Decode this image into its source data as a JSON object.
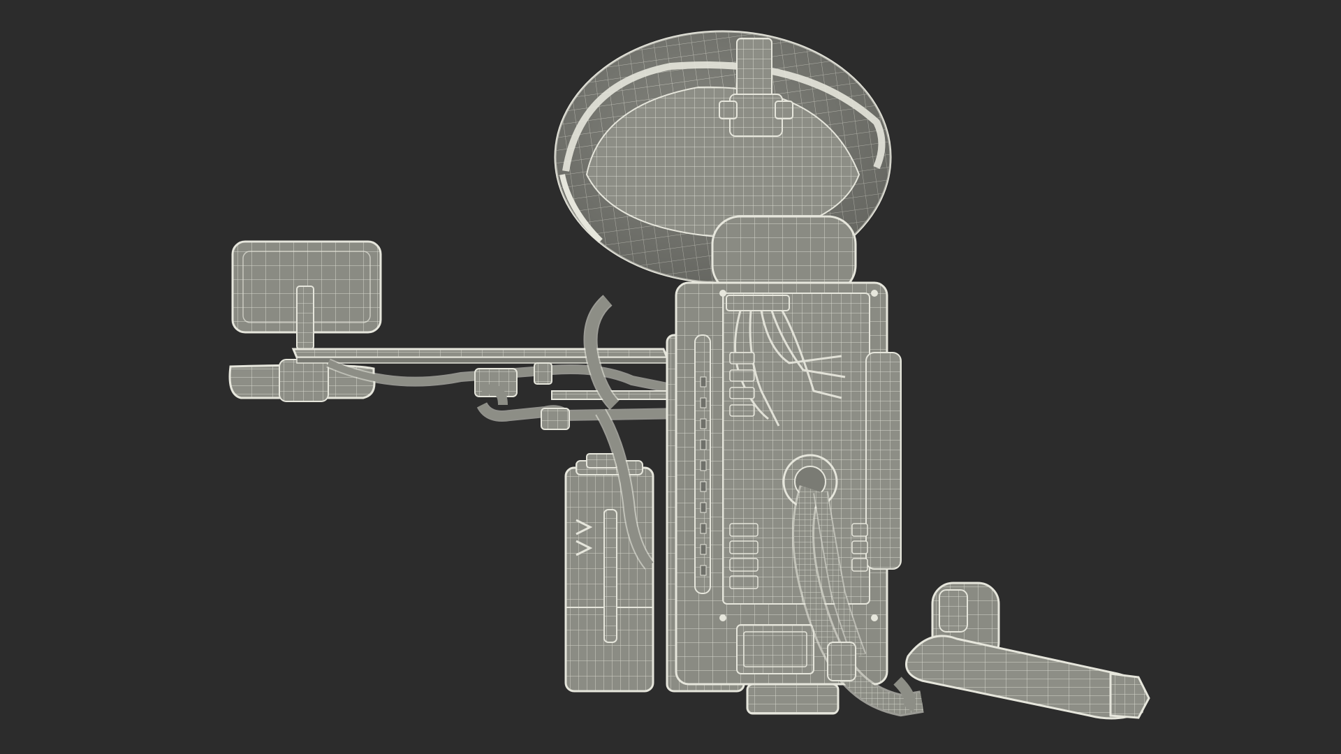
{
  "viewport": {
    "background": "#2c2c2c",
    "wire_color": "#e6e6dc",
    "fill_color": "#8d8e86",
    "fill_dark": "#6f706a"
  },
  "model": {
    "subject": "wireframe-backpack-sprayer",
    "parts": [
      "helmet",
      "display-monitor",
      "arm-tray",
      "backpack-body",
      "gas-canister",
      "hose",
      "spray-lance"
    ]
  }
}
